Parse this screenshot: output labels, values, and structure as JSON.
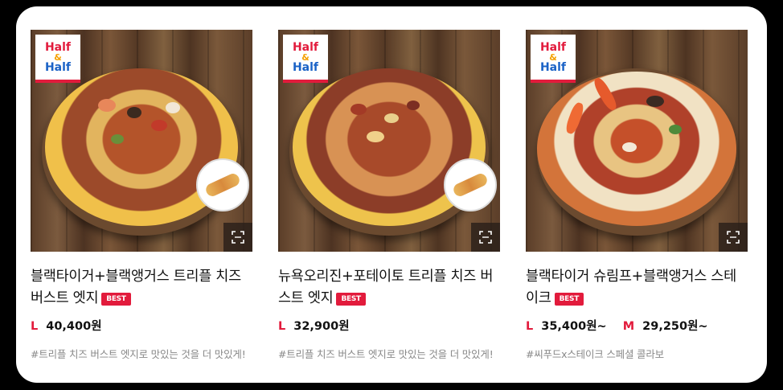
{
  "colors": {
    "accent": "#e21b3c",
    "panel": "#ffffff",
    "frame": "#000000"
  },
  "logo": {
    "line1": "Half",
    "line2": "&",
    "line3": "Half"
  },
  "zoom_icon": "expand-icon",
  "products": [
    {
      "name": "블랙타이거+블랙앵거스 트리플 치즈 버스트 엣지",
      "badge": "BEST",
      "price_size_1": "L",
      "price_1": "40,400원",
      "price_size_2": "",
      "price_2": "",
      "description": "#트리플 치즈 버스트 엣지로 맛있는 것을 더 맛있게!"
    },
    {
      "name": "뉴욕오리진+포테이토 트리플 치즈 버스트 엣지",
      "badge": "BEST",
      "price_size_1": "L",
      "price_1": "32,900원",
      "price_size_2": "",
      "price_2": "",
      "description": "#트리플 치즈 버스트 엣지로 맛있는 것을 더 맛있게!"
    },
    {
      "name": "블랙타이거 슈림프+블랙앵거스 스테이크",
      "badge": "BEST",
      "price_size_1": "L",
      "price_1": "35,400원~",
      "price_size_2": "M",
      "price_2": "29,250원~",
      "description": "#씨푸드x스테이크 스페셜 콜라보"
    }
  ]
}
